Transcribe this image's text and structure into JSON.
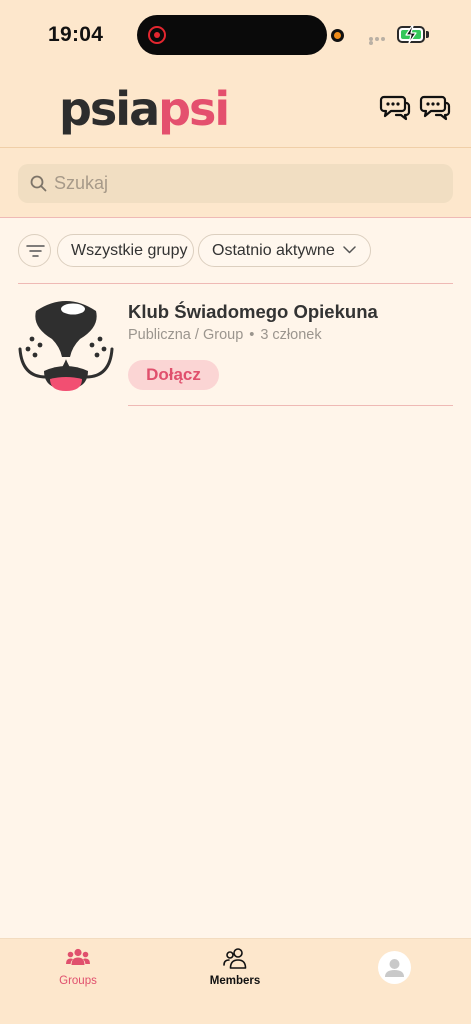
{
  "status_bar": {
    "time": "19:04"
  },
  "header": {
    "logo_part1": "psi",
    "logo_part2": "a",
    "logo_part3": "psi",
    "icons": [
      "chat-bubbles-icon",
      "chat-bubbles-icon"
    ]
  },
  "search": {
    "placeholder": "Szukaj"
  },
  "filters": {
    "all_groups_label": "Wszystkie grupy",
    "sort_label": "Ostatnio aktywne"
  },
  "groups": [
    {
      "name": "Klub Świadomego Opiekuna",
      "privacy": "Publiczna / Group",
      "separator": "•",
      "members": "3 członek",
      "join_label": "Dołącz"
    }
  ],
  "tab_bar": {
    "groups_label": "Groups",
    "members_label": "Members"
  },
  "colors": {
    "accent": "#e0506d",
    "header_bg": "#fde7cc",
    "page_bg": "#fff5ea",
    "join_bg": "#fbd5d4"
  }
}
